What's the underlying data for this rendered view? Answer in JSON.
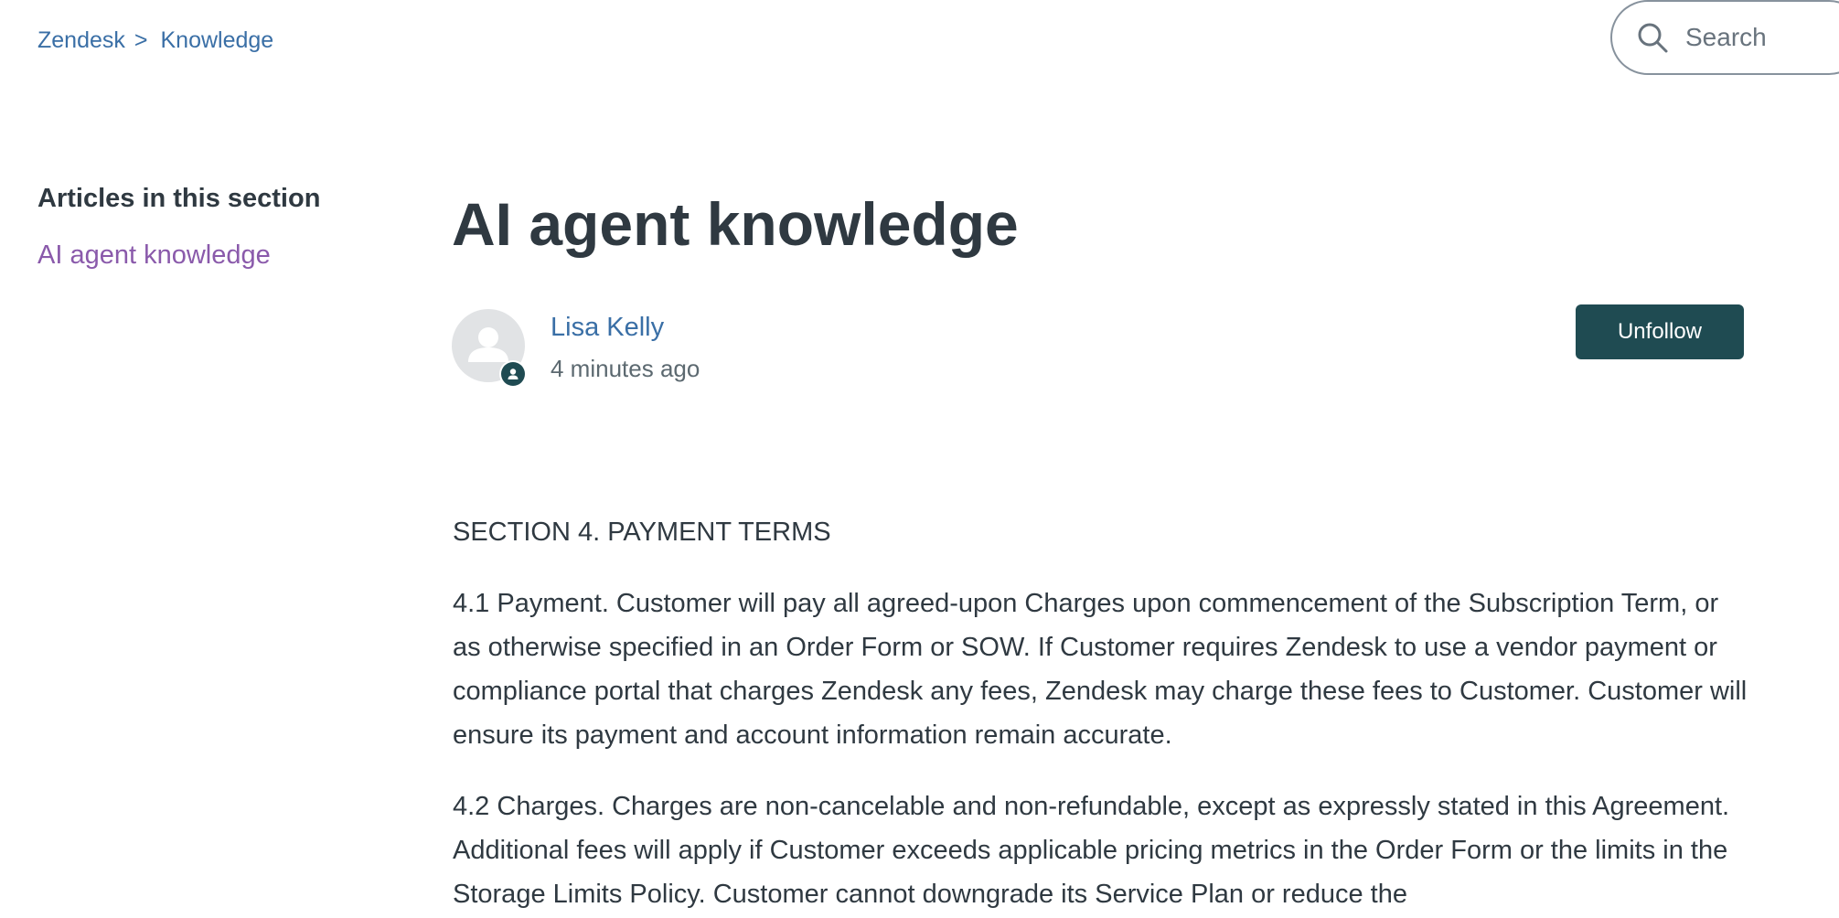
{
  "breadcrumb": {
    "items": [
      "Zendesk",
      "Knowledge"
    ],
    "separator": ">"
  },
  "search": {
    "placeholder": "Search",
    "value": ""
  },
  "sidebar": {
    "heading": "Articles in this section",
    "items": [
      {
        "label": "AI agent knowledge"
      }
    ]
  },
  "article": {
    "title": "AI agent knowledge",
    "author": {
      "name": "Lisa Kelly",
      "time": "4 minutes ago"
    },
    "follow_label": "Unfollow",
    "body": [
      "SECTION 4. PAYMENT TERMS",
      "4.1 Payment. Customer will pay all agreed-upon Charges upon commencement of the Subscription Term, or as otherwise specified in an Order Form or SOW. If Customer requires Zendesk to use a vendor payment or compliance portal that charges Zendesk any fees, Zendesk may charge these fees to Customer. Customer will ensure its payment and account information remain accurate.",
      "4.2 Charges. Charges are non-cancelable and non-refundable, except as expressly stated in this Agreement. Additional fees will apply if Customer exceeds applicable pricing metrics in the Order Form or the limits in the Storage Limits Policy. Customer cannot downgrade its Service Plan or reduce the"
    ]
  },
  "colors": {
    "link": "#3a6fa6",
    "visited_link": "#8a5aab",
    "text": "#2f3941",
    "button": "#1f4b52"
  },
  "icons": {
    "search": "search-icon",
    "avatar": "user-avatar-icon",
    "badge": "agent-badge-icon"
  }
}
